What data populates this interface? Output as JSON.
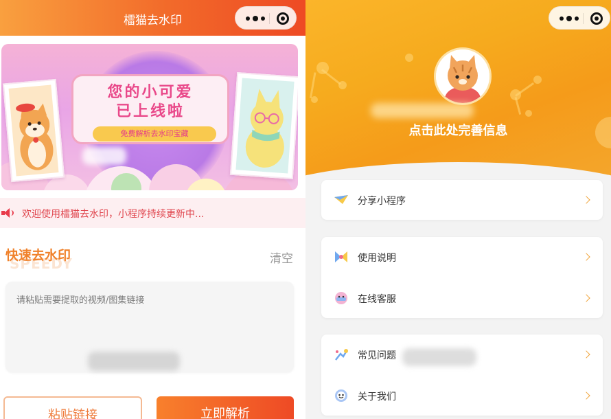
{
  "colors": {
    "brand_orange": "#f26a2a",
    "header_yellow": "#fbb52a",
    "notice_red": "#e0464e",
    "chevron": "#f0a43b"
  },
  "left_screen": {
    "nav": {
      "title": "檑猫去水印",
      "capsule_icons": [
        "more-dots-icon",
        "close-circle-icon"
      ]
    },
    "banner": {
      "headline_line1": "您的小可爱",
      "headline_line2": "已上线啦",
      "tagline": "免费解析去水印宝藏"
    },
    "notice": {
      "icon": "speaker-icon",
      "text": "欢迎使用檑猫去水印，小程序持续更新中..."
    },
    "section": {
      "title": "快速去水印",
      "bg_word": "SPEEDY",
      "clear_label": "清空"
    },
    "input": {
      "placeholder": "请粘贴需要提取的视频/图集链接"
    },
    "buttons": {
      "paste_label": "粘贴链接",
      "parse_label": "立即解析"
    }
  },
  "right_screen": {
    "nav": {
      "capsule_icons": [
        "more-dots-icon",
        "close-circle-icon"
      ]
    },
    "profile": {
      "prompt": "点击此处完善信息"
    },
    "menu_groups": [
      {
        "items": [
          {
            "icon": "share-icon",
            "label": "分享小程序"
          }
        ]
      },
      {
        "items": [
          {
            "icon": "guide-icon",
            "label": "使用说明"
          },
          {
            "icon": "service-icon",
            "label": "在线客服"
          }
        ]
      },
      {
        "items": [
          {
            "icon": "question-icon",
            "label": "常见问题"
          },
          {
            "icon": "about-icon",
            "label": "关于我们"
          }
        ]
      }
    ]
  }
}
